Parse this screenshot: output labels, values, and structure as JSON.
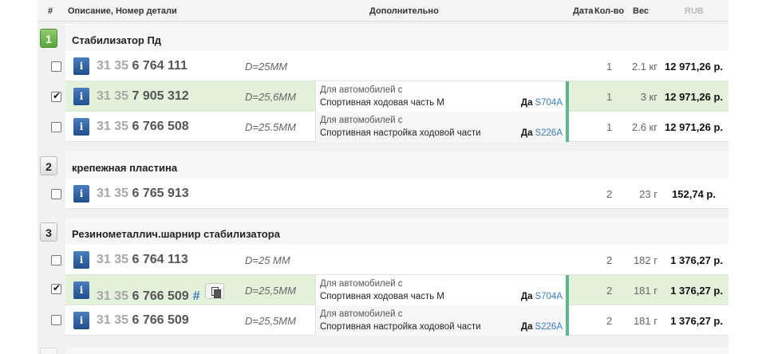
{
  "header": {
    "col_num": "#",
    "col_desc": "Описание, Номер детали",
    "col_extra": "Дополнительно",
    "col_date": "Дата",
    "col_qty": "Кол-во",
    "col_weight": "Вес",
    "col_currency": "RUB"
  },
  "groups": [
    {
      "number": "1",
      "title": "Стабилизатор Пд",
      "rows": [
        {
          "checked": false,
          "pn_prefix": "31 35",
          "pn_main": "6 764 111",
          "dim": "D=25MM",
          "note_label": "",
          "note_text": "",
          "note_yes": "",
          "note_code": "",
          "qty": "1",
          "weight": "2.1 кг",
          "price": "12 971,26 р."
        },
        {
          "checked": true,
          "pn_prefix": "31 35",
          "pn_main": "7 905 312",
          "dim": "D=25,6MM",
          "note_label": "Для автомобилей с",
          "note_text": "Спортивная ходовая часть M",
          "note_yes": "Да",
          "note_code": "S704A",
          "qty": "1",
          "weight": "3 кг",
          "price": "12 971,26 р."
        },
        {
          "checked": false,
          "pn_prefix": "31 35",
          "pn_main": "6 766 508",
          "dim": "D=25.5MM",
          "note_label": "Для автомобилей с",
          "note_text": "Спортивная настройка ходовой части",
          "note_yes": "Да",
          "note_code": "S226A",
          "qty": "1",
          "weight": "2.6 кг",
          "price": "12 971,26 р."
        }
      ]
    },
    {
      "number": "2",
      "title": "крепежная пластина",
      "rows": [
        {
          "checked": false,
          "pn_prefix": "31 35",
          "pn_main": "6 765 913",
          "dim": "",
          "note_label": "",
          "note_text": "",
          "note_yes": "",
          "note_code": "",
          "qty": "2",
          "weight": "23 г",
          "price": "152,74 р."
        }
      ]
    },
    {
      "number": "3",
      "title": "Резинометаллич.шарнир стабилизатора",
      "rows": [
        {
          "checked": false,
          "pn_prefix": "31 35",
          "pn_main": "6 764 113",
          "dim": "D=25 MM",
          "note_label": "",
          "note_text": "",
          "note_yes": "",
          "note_code": "",
          "qty": "2",
          "weight": "182 г",
          "price": "1 376,27 р."
        },
        {
          "checked": true,
          "pn_prefix": "31 35",
          "pn_main": "6 766 509",
          "hash": "#",
          "dim": "D=25,5MM",
          "note_label": "Для автомобилей с",
          "note_text": "Спортивная ходовая часть M",
          "note_yes": "Да",
          "note_code": "S704A",
          "qty": "2",
          "weight": "181 г",
          "price": "1 376,27 р."
        },
        {
          "checked": false,
          "pn_prefix": "31 35",
          "pn_main": "6 766 509",
          "dim": "D=25,5MM",
          "note_label": "Для автомобилей с",
          "note_text": "Спортивная настройка ходовой части",
          "note_yes": "Да",
          "note_code": "S226A",
          "qty": "2",
          "weight": "181 г",
          "price": "1 376,27 р."
        }
      ]
    }
  ],
  "icons": {
    "info": "i"
  },
  "colors": {
    "accent_green": "#5fb58c",
    "selected_row": "#e3f1da",
    "link_blue": "#3b7cc4"
  }
}
